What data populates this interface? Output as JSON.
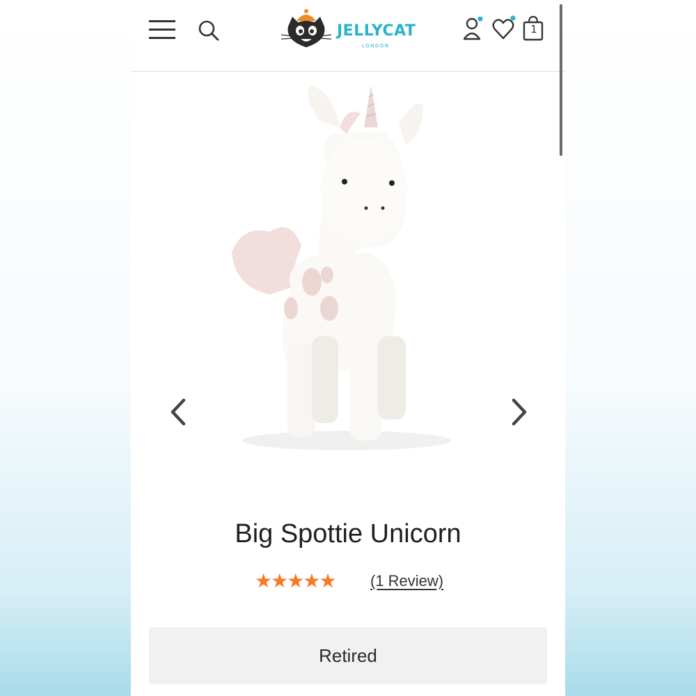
{
  "header": {
    "brand": "JELLYCAT",
    "brand_sub": "LONDON",
    "bag_count": "1"
  },
  "product": {
    "title": "Big Spottie Unicorn",
    "rating": 5,
    "stars": [
      "★",
      "★",
      "★",
      "★",
      "★"
    ],
    "review_link": "(1 Review)",
    "status": "Retired"
  },
  "colors": {
    "accent_teal": "#2ab2c8",
    "star_orange": "#f47b20",
    "logo_orange": "#f08a24"
  },
  "icons": [
    "menu-icon",
    "search-icon",
    "account-icon",
    "heart-icon",
    "bag-icon",
    "chevron-left-icon",
    "chevron-right-icon"
  ]
}
